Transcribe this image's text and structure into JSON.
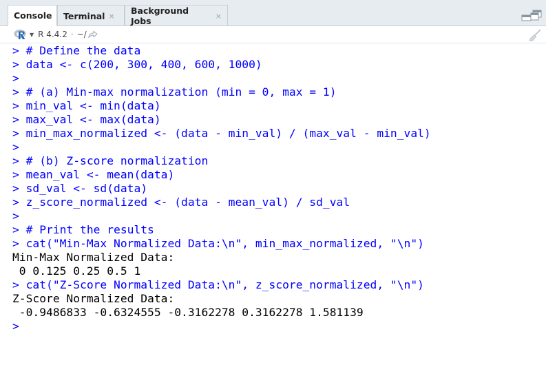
{
  "tabs": [
    {
      "label": "Console",
      "active": true,
      "closable": false
    },
    {
      "label": "Terminal",
      "active": false,
      "closable": true
    },
    {
      "label": "Background Jobs",
      "active": false,
      "closable": true
    }
  ],
  "tab_close_glyph": "×",
  "toolbar": {
    "r_version": "R 4.4.2",
    "separator": "·",
    "path": "~/",
    "icons": [
      "r-logo-icon",
      "chevron-down-icon",
      "goto-directory-icon",
      "clear-console-broom-icon",
      "minimize-icon",
      "maximize-icon"
    ]
  },
  "console": {
    "lines": [
      {
        "type": "cmd",
        "text": "> # Define the data"
      },
      {
        "type": "cmd",
        "text": "> data <- c(200, 300, 400, 600, 1000)"
      },
      {
        "type": "cmd",
        "text": ">"
      },
      {
        "type": "cmd",
        "text": "> # (a) Min-max normalization (min = 0, max = 1)"
      },
      {
        "type": "cmd",
        "text": "> min_val <- min(data)"
      },
      {
        "type": "cmd",
        "text": "> max_val <- max(data)"
      },
      {
        "type": "cmd",
        "text": "> min_max_normalized <- (data - min_val) / (max_val - min_val)"
      },
      {
        "type": "cmd",
        "text": ">"
      },
      {
        "type": "cmd",
        "text": "> # (b) Z-score normalization"
      },
      {
        "type": "cmd",
        "text": "> mean_val <- mean(data)"
      },
      {
        "type": "cmd",
        "text": "> sd_val <- sd(data)"
      },
      {
        "type": "cmd",
        "text": "> z_score_normalized <- (data - mean_val) / sd_val"
      },
      {
        "type": "cmd",
        "text": ">"
      },
      {
        "type": "cmd",
        "text": "> # Print the results"
      },
      {
        "type": "cmd",
        "text": "> cat(\"Min-Max Normalized Data:\\n\", min_max_normalized, \"\\n\")"
      },
      {
        "type": "out",
        "text": "Min-Max Normalized Data:"
      },
      {
        "type": "out",
        "text": " 0 0.125 0.25 0.5 1"
      },
      {
        "type": "cmd",
        "text": "> cat(\"Z-Score Normalized Data:\\n\", z_score_normalized, \"\\n\")"
      },
      {
        "type": "out",
        "text": "Z-Score Normalized Data:"
      },
      {
        "type": "out",
        "text": " -0.9486833 -0.6324555 -0.3162278 0.3162278 1.581139"
      },
      {
        "type": "cmd",
        "text": ">"
      }
    ]
  },
  "colors": {
    "command": "#0000ff",
    "output": "#000000",
    "tabbar_bg": "#e7ecf1",
    "r_logo_blue": "#1f65b7"
  }
}
